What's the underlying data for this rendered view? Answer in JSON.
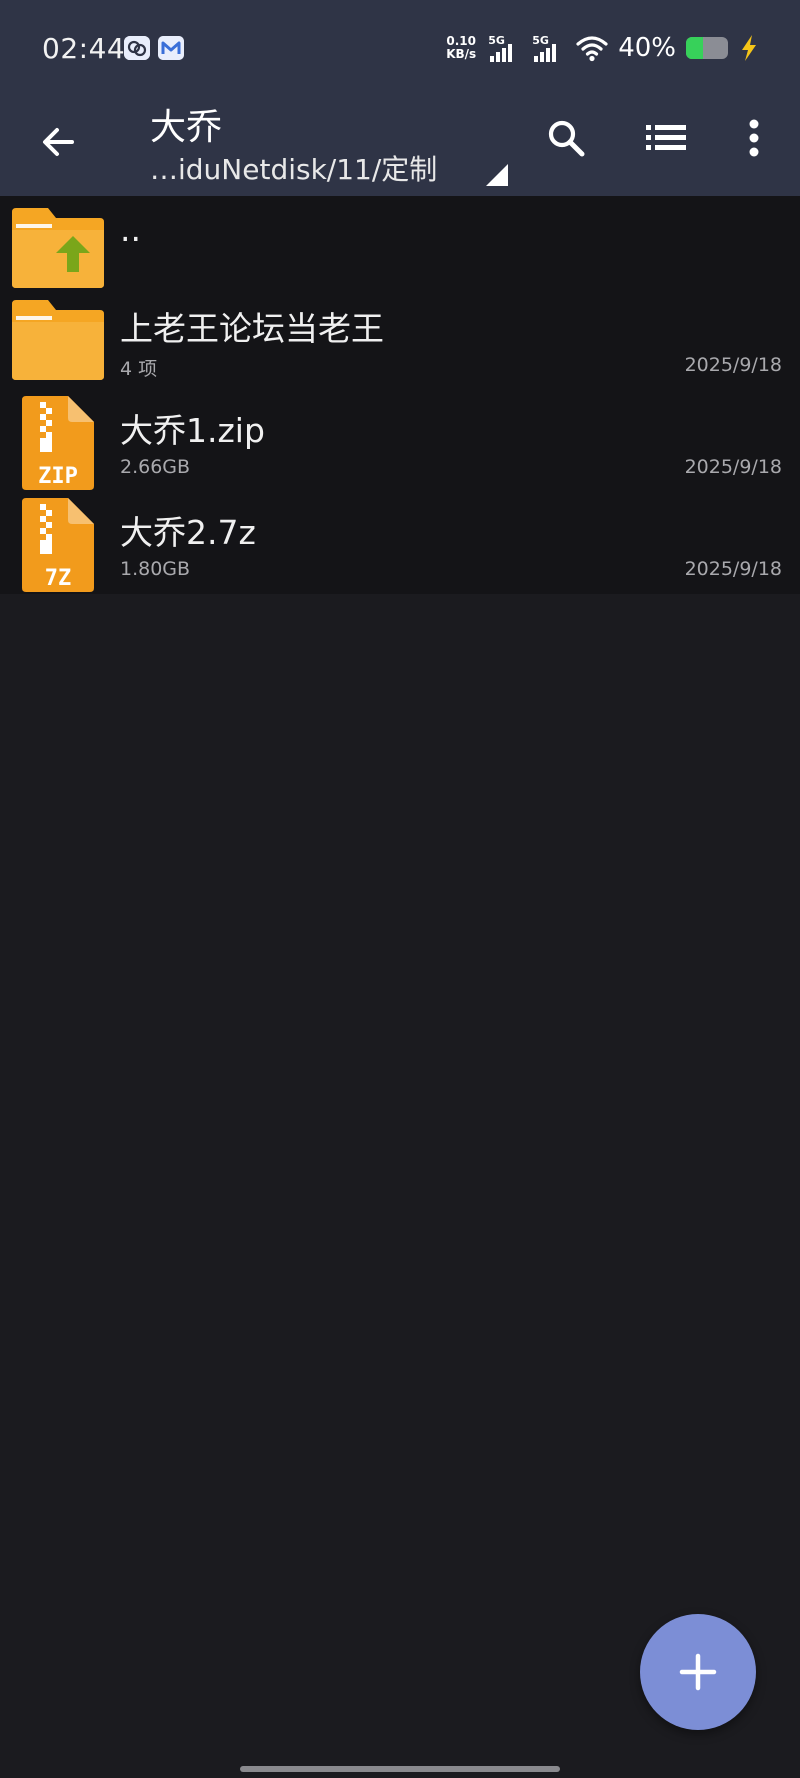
{
  "status_bar": {
    "time": "02:44",
    "net_speed_value": "0.10",
    "net_speed_unit": "KB/s",
    "sim1_label": "5G",
    "sim2_label": "5G",
    "battery_percent_text": "40%",
    "battery_level": 0.4,
    "icons": [
      "cloud-app-icon",
      "mail-app-icon",
      "signal-icon",
      "wifi-icon",
      "battery-icon",
      "charging-bolt-icon"
    ]
  },
  "toolbar": {
    "title": "大乔",
    "path": "…iduNetdisk/11/定制",
    "icons": [
      "back-arrow-icon",
      "path-dropdown-icon",
      "search-icon",
      "list-view-icon",
      "more-vert-icon"
    ]
  },
  "files": [
    {
      "name": "..",
      "meta": "",
      "date": "",
      "type": "parent-folder"
    },
    {
      "name": "上老王论坛当老王",
      "meta": "4 项",
      "date": "2025/9/18",
      "type": "folder"
    },
    {
      "name": "大乔1.zip",
      "meta": "2.66GB",
      "date": "2025/9/18",
      "type": "zip",
      "badge": "ZIP"
    },
    {
      "name": "大乔2.7z",
      "meta": "1.80GB",
      "date": "2025/9/18",
      "type": "7z",
      "badge": "7Z"
    }
  ],
  "colors": {
    "toolbar_bg": "#2f3446",
    "list_bg": "#141417",
    "page_bg": "#1b1b1f",
    "folder": "#f5a623",
    "archive": "#f29b1c",
    "fab": "#7c8ed6",
    "up_arrow": "#7aa61a"
  },
  "fab": {
    "icon": "plus-icon"
  }
}
